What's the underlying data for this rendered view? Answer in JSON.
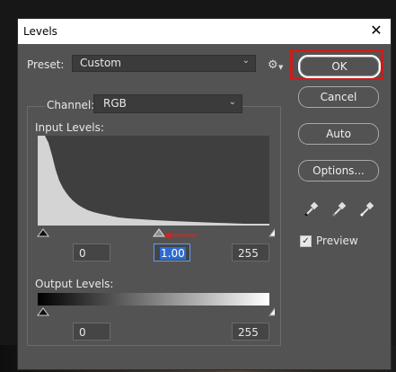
{
  "window": {
    "title": "Levels"
  },
  "preset": {
    "label": "Preset:",
    "value": "Custom"
  },
  "channel": {
    "label": "Channel:",
    "value": "RGB"
  },
  "input_levels": {
    "label": "Input Levels:",
    "black": "0",
    "gamma": "1.00",
    "white": "255"
  },
  "output_levels": {
    "label": "Output Levels:",
    "black": "0",
    "white": "255"
  },
  "buttons": {
    "ok": "OK",
    "cancel": "Cancel",
    "auto": "Auto",
    "options": "Options..."
  },
  "preview": {
    "label": "Preview",
    "checked": true
  },
  "icons": [
    "close-icon",
    "chevron-down-icon",
    "gear-icon",
    "black-eyedropper-icon",
    "gray-eyedropper-icon",
    "white-eyedropper-icon",
    "red-arrow-annotation"
  ],
  "colors": {
    "dialog_bg": "#535353",
    "highlight": "#d11a1a",
    "selection": "#2f6bcf"
  }
}
